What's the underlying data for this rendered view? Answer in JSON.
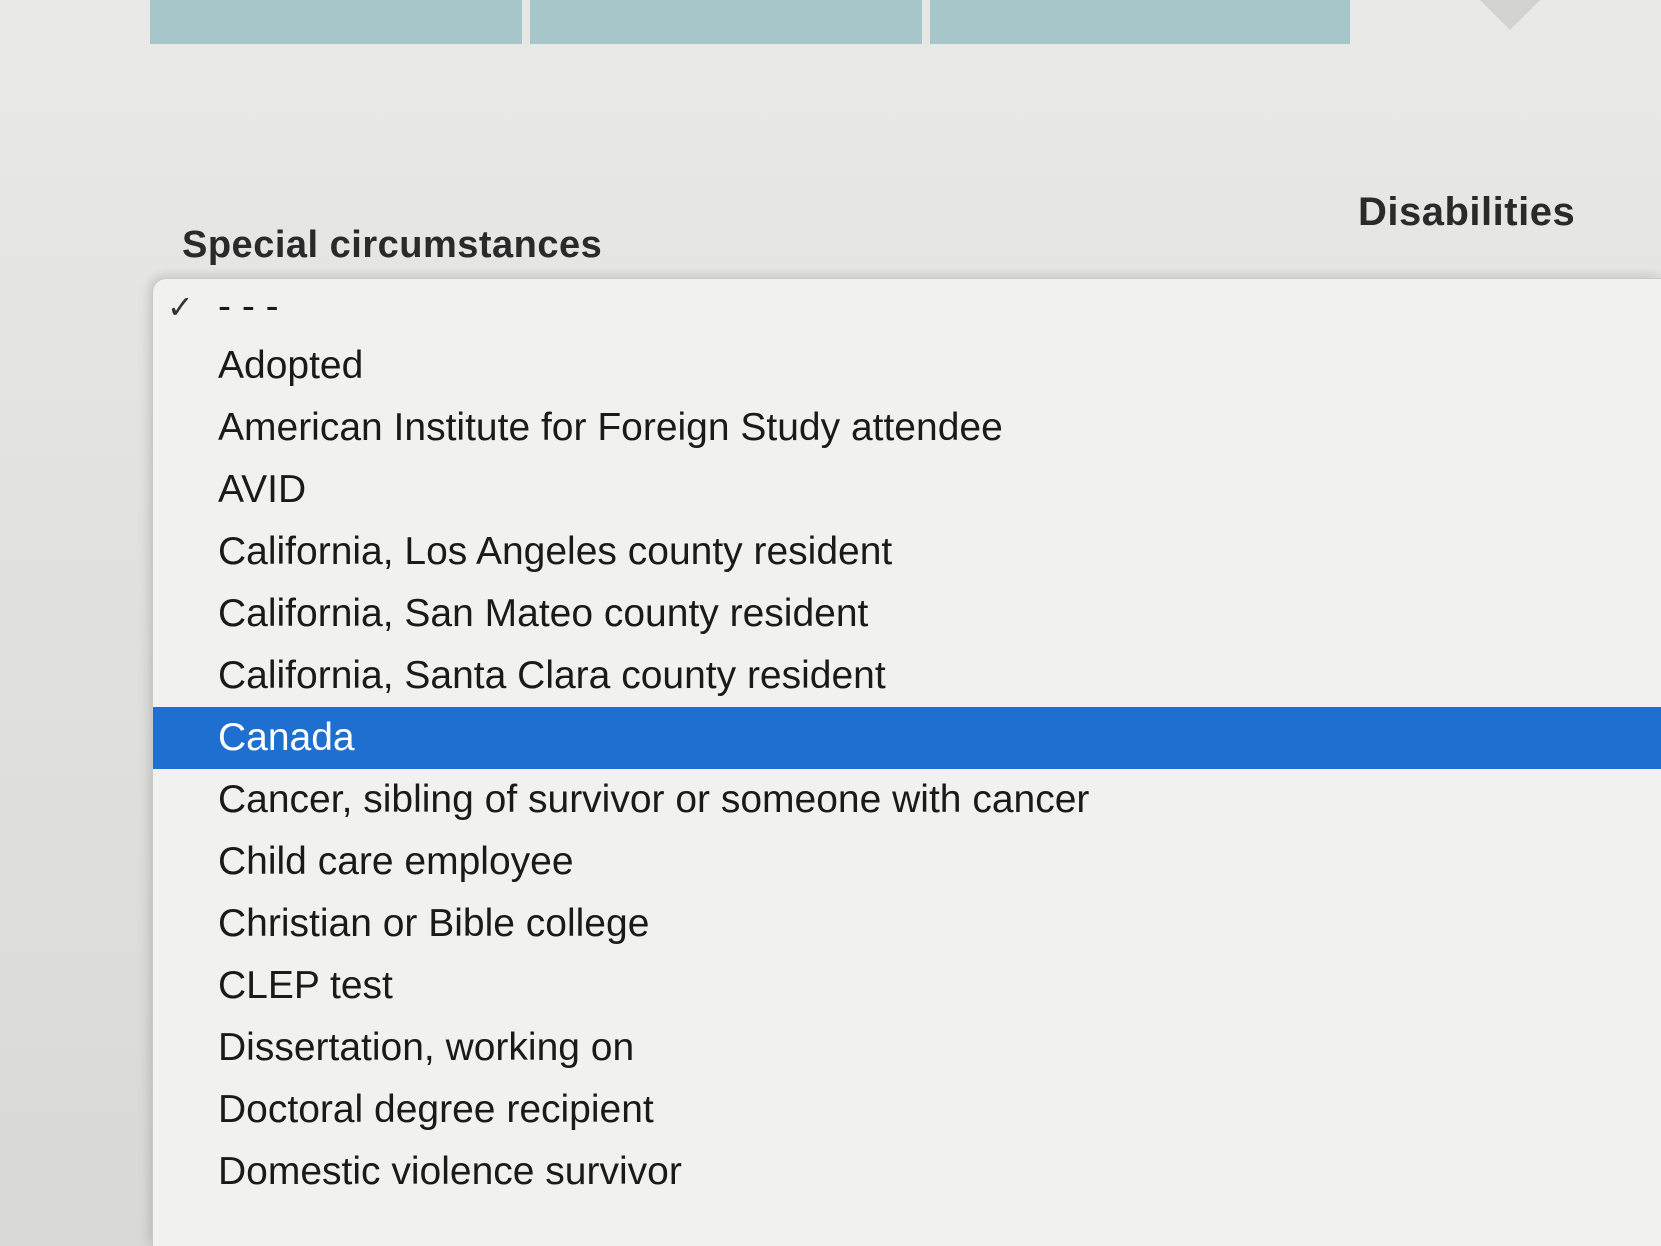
{
  "labels": {
    "special_circumstances": "Special circumstances",
    "disabilities": "Disabilities"
  },
  "dropdown": {
    "checked_index": 0,
    "highlighted_index": 7,
    "highlight_color": "#1f6fd1",
    "items": [
      "- - -",
      "Adopted",
      "American Institute for Foreign Study attendee",
      "AVID",
      "California, Los Angeles county resident",
      "California, San Mateo county resident",
      "California, Santa Clara county resident",
      "Canada",
      "Cancer, sibling of survivor or someone with cancer",
      "Child care employee",
      "Christian or Bible college",
      "CLEP test",
      "Dissertation, working on",
      "Doctoral degree recipient",
      "Domestic violence survivor"
    ]
  }
}
